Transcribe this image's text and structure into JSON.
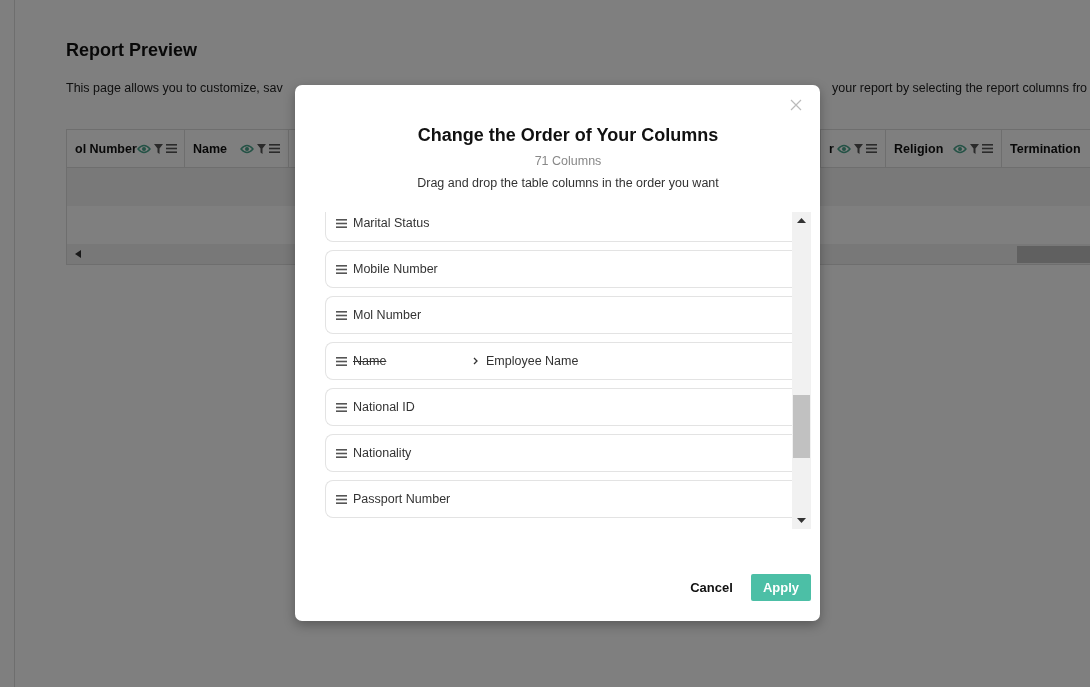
{
  "page": {
    "title": "Report Preview",
    "description_fragments": [
      "This page allows you to customize, sav",
      "your report by selecting the report columns fro"
    ]
  },
  "table": {
    "columns": [
      {
        "label": "ol Number"
      },
      {
        "label": "Name"
      },
      {
        "label": "r"
      },
      {
        "label": "Religion"
      },
      {
        "label": "Termination"
      }
    ]
  },
  "dialog": {
    "title": "Change the Order of Your Columns",
    "count": "71 Columns",
    "subtitle": "Drag and drop the table columns in the order you want",
    "items": [
      {
        "label": "Marital Status"
      },
      {
        "label": "Mobile Number"
      },
      {
        "label": "Mol Number"
      },
      {
        "label": "Name",
        "renamed_to": "Employee Name"
      },
      {
        "label": "National ID"
      },
      {
        "label": "Nationality"
      },
      {
        "label": "Passport Number"
      }
    ],
    "buttons": {
      "cancel": "Cancel",
      "apply": "Apply"
    }
  }
}
